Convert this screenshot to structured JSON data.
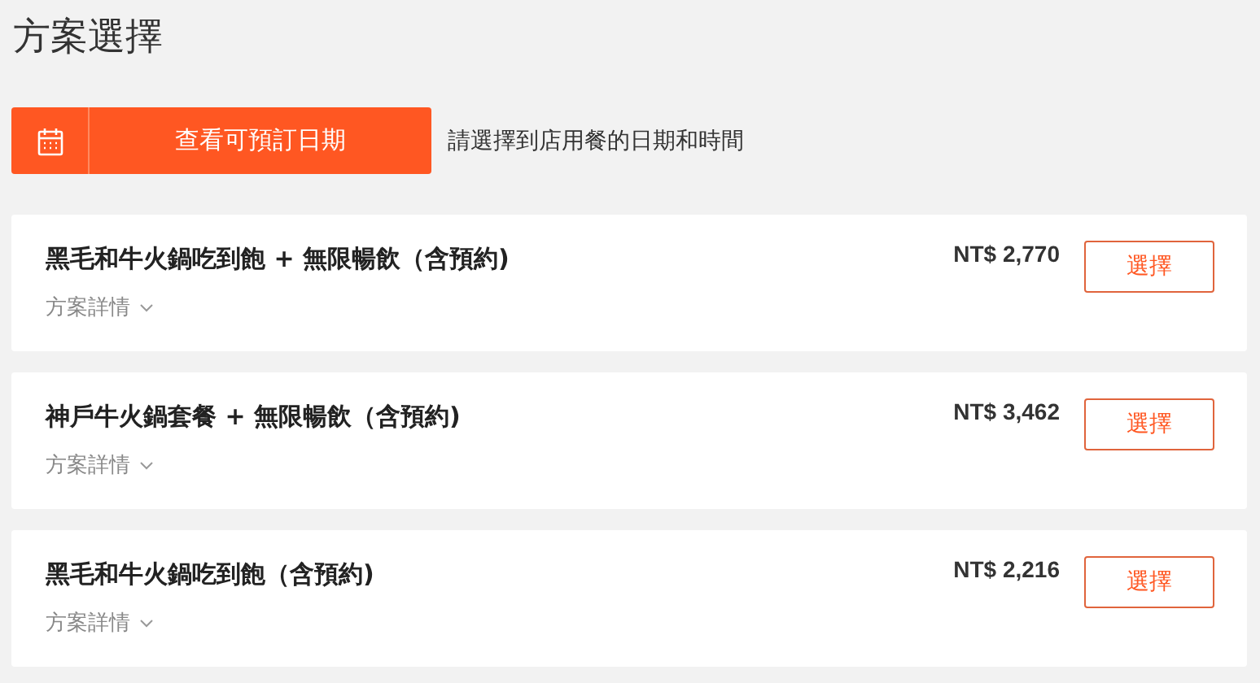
{
  "title": "方案選擇",
  "date_button": {
    "label": "查看可預訂日期"
  },
  "hint": "請選擇到店用餐的日期和時間",
  "plans": [
    {
      "name": "黑毛和牛火鍋吃到飽 + 無限暢飲（含預約)",
      "details": "方案詳情",
      "price": "NT$ 2,770",
      "button": "選擇"
    },
    {
      "name": "神戶牛火鍋套餐 + 無限暢飲（含預約)",
      "details": "方案詳情",
      "price": "NT$ 3,462",
      "button": "選擇"
    },
    {
      "name": "黑毛和牛火鍋吃到飽（含預約)",
      "details": "方案詳情",
      "price": "NT$ 2,216",
      "button": "選擇"
    }
  ]
}
